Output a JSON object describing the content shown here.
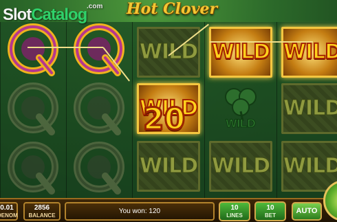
{
  "watermark": {
    "part1": "Slot",
    "part2": "Catalog",
    "suffix": ".com"
  },
  "game_title": "Hot Clover",
  "symbols": {
    "q": "Q",
    "wild": "WILD"
  },
  "win_amount_overlay": "20",
  "bottom": {
    "bet_value": "0.01",
    "bet_label_partial": "DENOM",
    "balance_value": "2856",
    "balance_label": "BALANCE",
    "message": "You won: 120",
    "lines_value": "10",
    "lines_label": "LINES",
    "bet_amount": "10",
    "bet_label": "BET",
    "auto_label": "AUTO"
  },
  "colors": {
    "accent_gold": "#f3c733",
    "brand_green": "#2fd16a"
  }
}
